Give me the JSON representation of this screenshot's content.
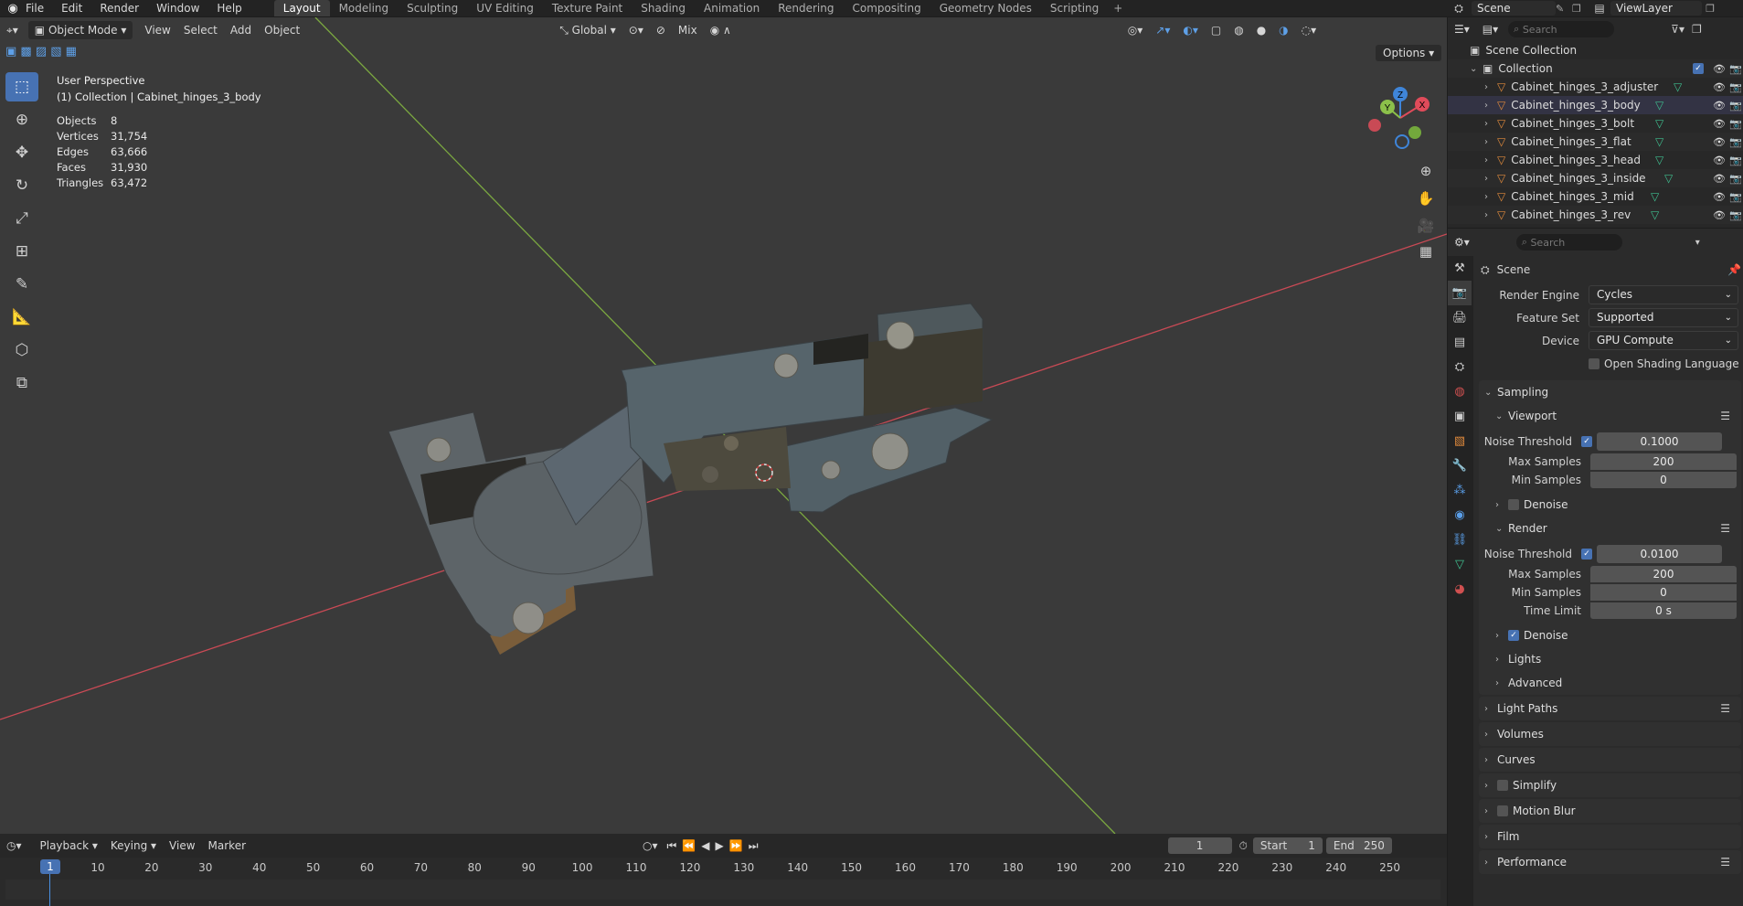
{
  "topbar": {
    "menu": [
      "File",
      "Edit",
      "Render",
      "Window",
      "Help"
    ],
    "workspaces": [
      "Layout",
      "Modeling",
      "Sculpting",
      "UV Editing",
      "Texture Paint",
      "Shading",
      "Animation",
      "Rendering",
      "Compositing",
      "Geometry Nodes",
      "Scripting"
    ],
    "active_workspace": "Layout",
    "scene": "Scene",
    "view_layer": "ViewLayer"
  },
  "viewport": {
    "mode": "Object Mode",
    "menus": [
      "View",
      "Select",
      "Add",
      "Object"
    ],
    "orientation": "Global",
    "snap_mode": "Mix",
    "options_label": "Options",
    "perspective": "User Perspective",
    "context": "(1) Collection | Cabinet_hinges_3_body",
    "stats": [
      {
        "label": "Objects",
        "value": "8"
      },
      {
        "label": "Vertices",
        "value": "31,754"
      },
      {
        "label": "Edges",
        "value": "63,666"
      },
      {
        "label": "Faces",
        "value": "31,930"
      },
      {
        "label": "Triangles",
        "value": "63,472"
      }
    ],
    "gizmo": {
      "x": "X",
      "y": "Y",
      "z": "Z"
    }
  },
  "timeline": {
    "menus": [
      "Playback",
      "Keying",
      "View",
      "Marker"
    ],
    "current_frame": "1",
    "start_label": "Start",
    "start": "1",
    "end_label": "End",
    "end": "250",
    "ticks": [
      "1",
      "10",
      "20",
      "30",
      "40",
      "50",
      "60",
      "70",
      "80",
      "90",
      "100",
      "110",
      "120",
      "130",
      "140",
      "150",
      "160",
      "170",
      "180",
      "190",
      "200",
      "210",
      "220",
      "230",
      "240",
      "250"
    ]
  },
  "outliner": {
    "search_placeholder": "Search",
    "scene_collection": "Scene Collection",
    "collection": "Collection",
    "objects": [
      "Cabinet_hinges_3_adjuster",
      "Cabinet_hinges_3_body",
      "Cabinet_hinges_3_bolt",
      "Cabinet_hinges_3_flat",
      "Cabinet_hinges_3_head",
      "Cabinet_hinges_3_inside",
      "Cabinet_hinges_3_mid",
      "Cabinet_hinges_3_rev"
    ]
  },
  "properties": {
    "search_placeholder": "Search",
    "context": "Scene",
    "render_engine_label": "Render Engine",
    "render_engine": "Cycles",
    "feature_set_label": "Feature Set",
    "feature_set": "Supported",
    "device_label": "Device",
    "device": "GPU Compute",
    "osl_label": "Open Shading Language",
    "sampling": "Sampling",
    "viewport_label": "Viewport",
    "noise_threshold_label": "Noise Threshold",
    "viewport_noise": "0.1000",
    "max_samples_label": "Max Samples",
    "viewport_max": "200",
    "min_samples_label": "Min Samples",
    "viewport_min": "0",
    "denoise_label": "Denoise",
    "render_label": "Render",
    "render_noise": "0.0100",
    "render_max": "200",
    "render_min": "0",
    "time_limit_label": "Time Limit",
    "time_limit": "0 s",
    "lights": "Lights",
    "advanced": "Advanced",
    "light_paths": "Light Paths",
    "volumes": "Volumes",
    "curves": "Curves",
    "simplify": "Simplify",
    "motion_blur": "Motion Blur",
    "film": "Film",
    "performance": "Performance"
  },
  "colors": {
    "accent": "#4772b3",
    "x_axis": "#e04b5a",
    "y_axis": "#8cc04a",
    "z_axis": "#3f85d9",
    "object_orange": "#e08a3c",
    "mesh_green": "#3fbf8f"
  }
}
